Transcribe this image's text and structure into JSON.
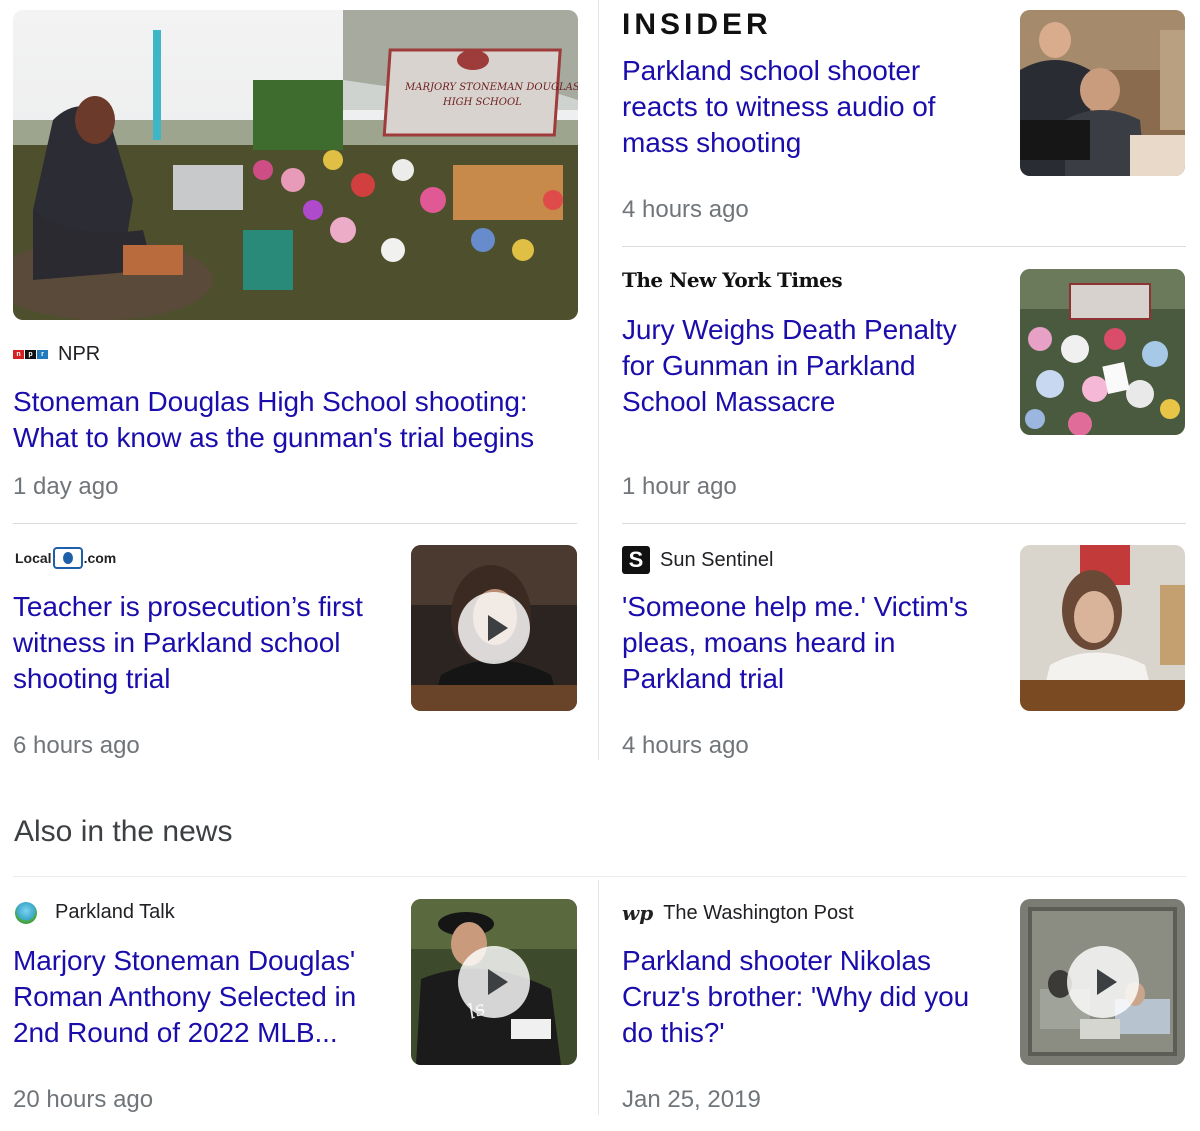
{
  "top_stories": [
    {
      "source": "NPR",
      "headline": "Stoneman Douglas High School shooting: What to know as the gunman's trial begins",
      "time": "1 day ago",
      "sign_text": "MARJORY STONEMAN DOUGLAS HIGH SCHOOL"
    },
    {
      "source": "INSIDER",
      "headline": "Parkland school shooter reacts to witness audio of mass shooting",
      "time": "4 hours ago"
    },
    {
      "source": "The New York Times",
      "headline": "Jury Weighs Death Penalty for Gunman in Parkland School Massacre",
      "time": "1 hour ago"
    },
    {
      "source_prefix": "Local",
      "source_suffix": ".com",
      "headline": "Teacher is prosecution’s first witness in Parkland school shooting trial",
      "time": "6 hours ago"
    },
    {
      "source": "Sun Sentinel",
      "logo_letter": "S",
      "headline": "'Someone help me.' Victim's pleas, moans heard in Parkland trial",
      "time": "4 hours ago"
    }
  ],
  "also_in_news": {
    "title": "Also in the news",
    "items": [
      {
        "source": "Parkland Talk",
        "headline": "Marjory Stoneman Douglas' Roman Anthony Selected in 2nd Round of 2022 MLB...",
        "time": "20 hours ago"
      },
      {
        "source": "The Washington Post",
        "logo_text": "wp",
        "headline": "Parkland shooter Nikolas Cruz's brother: 'Why did you do this?'",
        "time": "Jan 25, 2019"
      }
    ]
  },
  "colors": {
    "link": "#1a0dab",
    "meta": "#70757a",
    "divider": "#dadce0"
  },
  "icons": [
    "npr-logo",
    "insider-logo",
    "nyt-logo",
    "local10-logo",
    "sun-sentinel-logo",
    "parkland-talk-logo",
    "washington-post-logo",
    "play-icon"
  ]
}
